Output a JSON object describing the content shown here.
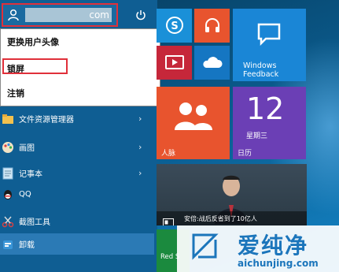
{
  "user": {
    "account_tail": "com"
  },
  "context_menu": {
    "change_avatar": "更换用户头像",
    "lock": "锁屏",
    "sign_out": "注销"
  },
  "apps": [
    {
      "label": "文件资源管理器",
      "icon": "folder-icon"
    },
    {
      "label": "画图",
      "icon": "paint-icon"
    },
    {
      "label": "记事本",
      "icon": "notepad-icon"
    },
    {
      "label": "QQ",
      "icon": "qq-icon"
    },
    {
      "label": "截图工具",
      "icon": "snipping-tool-icon"
    },
    {
      "label": "卸载",
      "icon": "uninstall-icon"
    }
  ],
  "tiles": {
    "feedback_line1": "Windows",
    "feedback_line2": "Feedback",
    "people": "人脉",
    "calendar_day": "12",
    "calendar_weekday": "星期三",
    "calendar": "日历",
    "news": "安倍:战后反省到了10亿人",
    "red_tile": "Red S"
  },
  "watermark": {
    "name": "爱纯净",
    "url": "aichunjing.com"
  },
  "colors": {
    "start_bg": "#0f5e93",
    "tile_blue": "#1576c2",
    "tile_orange": "#e8542e",
    "tile_purple": "#6b3fb5",
    "highlight": "#e0303a"
  }
}
